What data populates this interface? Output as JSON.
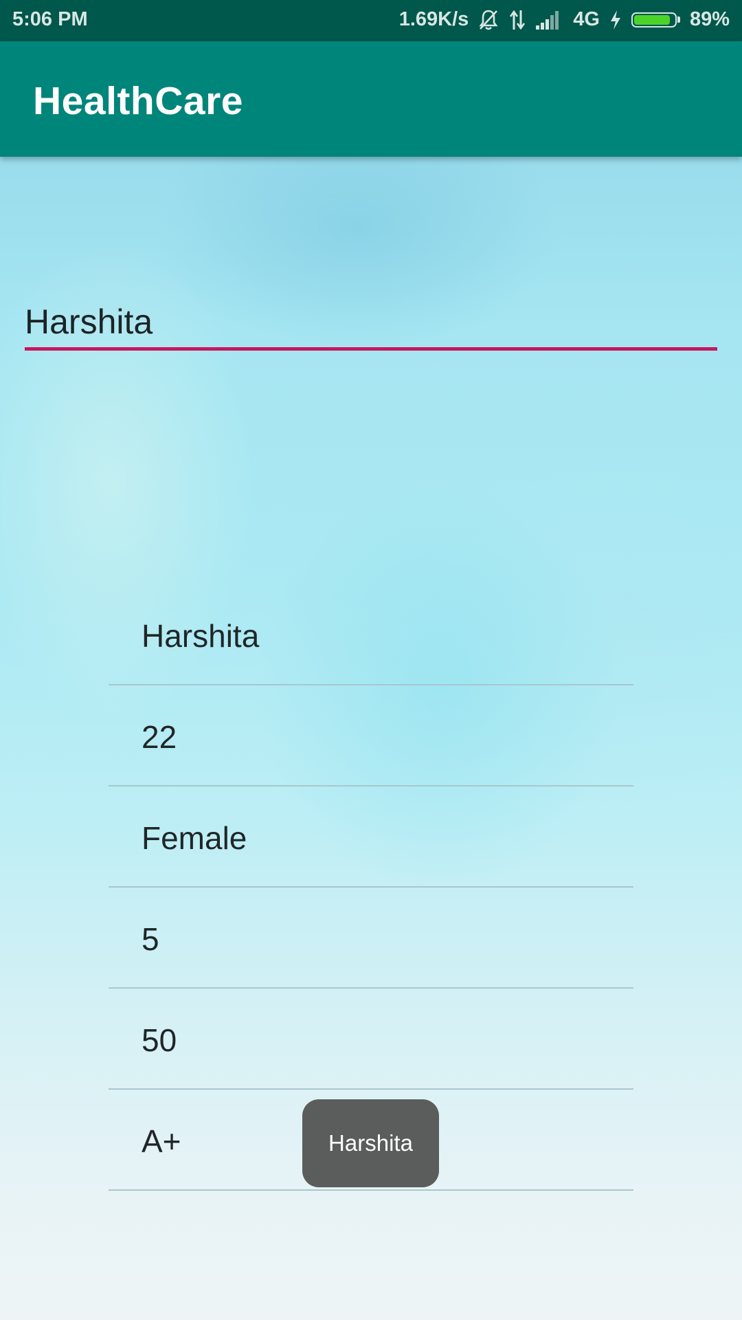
{
  "status_bar": {
    "time": "5:06 PM",
    "network_speed": "1.69K/s",
    "network_type": "4G",
    "battery_percent": "89%",
    "battery_level": 0.89,
    "icons": [
      "mute-bell-icon",
      "data-arrows-icon",
      "signal-icon",
      "charging-icon",
      "battery-icon"
    ]
  },
  "app_bar": {
    "title": "HealthCare"
  },
  "search": {
    "value": "Harshita"
  },
  "details": {
    "items": [
      {
        "value": "Harshita"
      },
      {
        "value": "22"
      },
      {
        "value": "Female"
      },
      {
        "value": "5"
      },
      {
        "value": "50"
      },
      {
        "value": "A+"
      }
    ]
  },
  "toast": {
    "text": "Harshita"
  },
  "colors": {
    "status_bar": "#00574b",
    "app_bar": "#00857a",
    "input_underline": "#c8175d",
    "toast_bg": "#5b5d5d",
    "battery_fill": "#4cd32a"
  }
}
